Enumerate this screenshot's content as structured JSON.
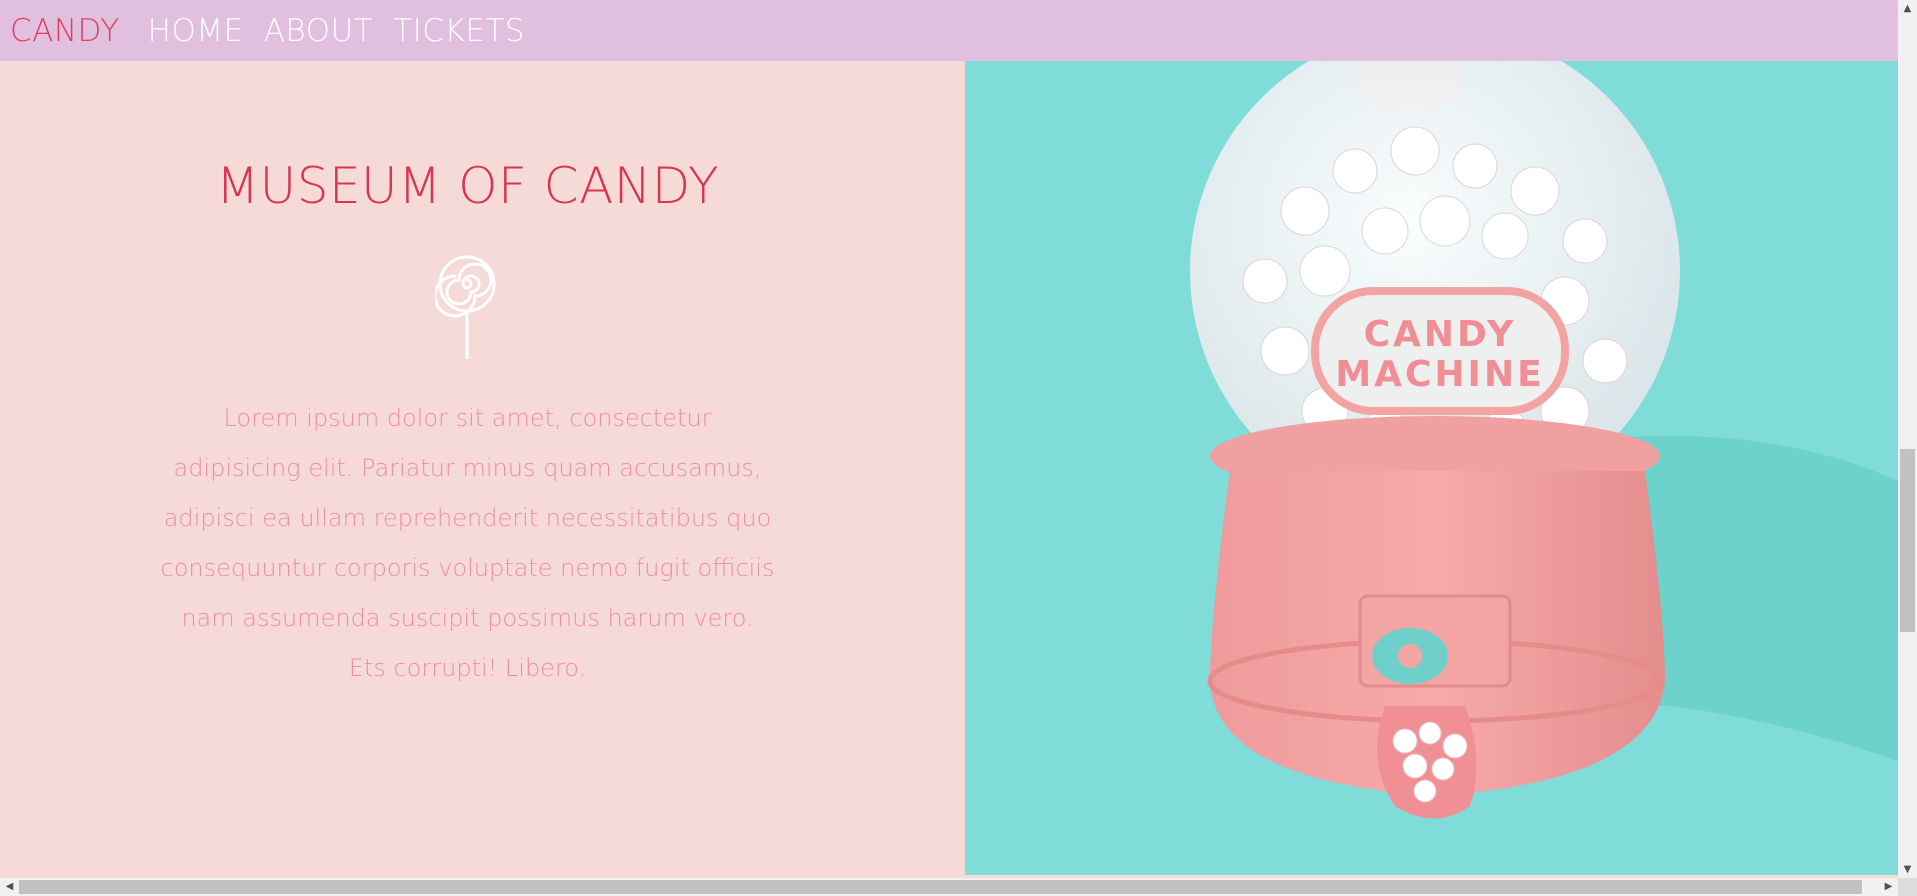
{
  "nav": {
    "brand": "CANDY",
    "links": [
      "HOME",
      "ABOUT",
      "TICKETS"
    ]
  },
  "hero": {
    "title": "MUSEUM OF CANDY",
    "icon": "lollipop-icon",
    "paragraph": "Lorem ipsum dolor sit amet, consectetur adipisicing elit. Pariatur minus quam accusamus, adipisci ea ullam reprehenderit necessitatibus quo consequuntur corporis voluptate nemo fugit officiis nam assumenda suscipit possimus harum vero. Ets corrupti! Libero."
  },
  "image": {
    "label_line1": "CANDY",
    "label_line2": "MACHINE"
  },
  "colors": {
    "nav_bg": "#e0bfdf",
    "brand": "#e0405a",
    "title": "#d8364f",
    "body_text": "#ee8fa0",
    "panel_bg": "#f6dad7",
    "image_bg": "#7fdcd8",
    "machine_pink": "#f4a3a3"
  },
  "scrollbars": {
    "vertical_position": 0.52,
    "horizontal_position": 0.0
  }
}
